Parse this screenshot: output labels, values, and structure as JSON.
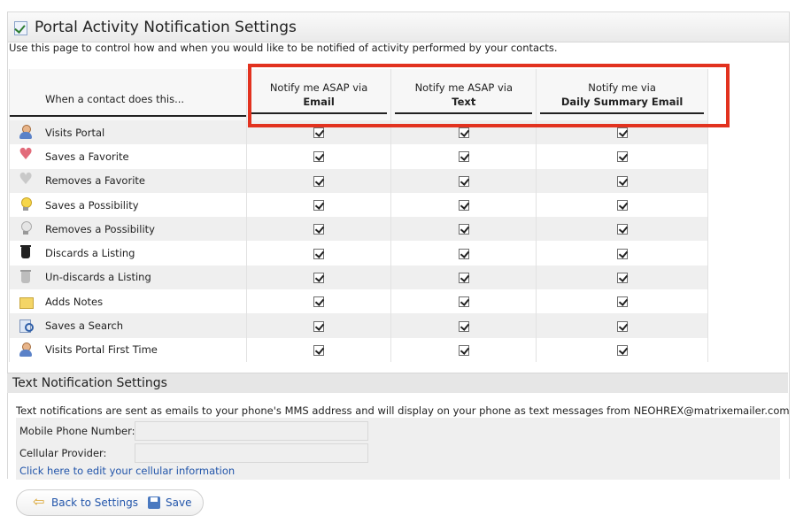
{
  "panel": {
    "title": "Portal Activity Notification Settings"
  },
  "intro": "Use this page to control how and when you would like to be notified of activity performed by your contacts.",
  "table": {
    "action_header": "When a contact does this...",
    "columns": [
      {
        "line1": "Notify me ASAP via",
        "line2": "Email"
      },
      {
        "line1": "Notify me ASAP via",
        "line2": "Text"
      },
      {
        "line1": "Notify me via",
        "line2": "Daily Summary Email"
      }
    ],
    "rows": [
      {
        "label": "Visits Portal",
        "icon": "person-icon",
        "email": true,
        "text": true,
        "daily": true
      },
      {
        "label": "Saves a Favorite",
        "icon": "heart-red-icon",
        "email": true,
        "text": true,
        "daily": true
      },
      {
        "label": "Removes a Favorite",
        "icon": "heart-grey-icon",
        "email": true,
        "text": true,
        "daily": true
      },
      {
        "label": "Saves a Possibility",
        "icon": "bulb-on-icon",
        "email": true,
        "text": true,
        "daily": true
      },
      {
        "label": "Removes a Possibility",
        "icon": "bulb-off-icon",
        "email": true,
        "text": true,
        "daily": true
      },
      {
        "label": "Discards a Listing",
        "icon": "trash-black-icon",
        "email": true,
        "text": true,
        "daily": true
      },
      {
        "label": "Un-discards a Listing",
        "icon": "trash-grey-icon",
        "email": true,
        "text": true,
        "daily": true
      },
      {
        "label": "Adds Notes",
        "icon": "note-icon",
        "email": true,
        "text": true,
        "daily": true
      },
      {
        "label": "Saves a Search",
        "icon": "search-icon",
        "email": true,
        "text": true,
        "daily": true
      },
      {
        "label": "Visits Portal First Time",
        "icon": "person-icon",
        "email": true,
        "text": true,
        "daily": true
      }
    ]
  },
  "text_settings": {
    "title": "Text Notification Settings",
    "description": "Text notifications are sent as emails to your phone's MMS address and will display on your phone as text messages from NEOHREX@matrixemailer.com",
    "mobile_label": "Mobile Phone Number:",
    "mobile_value": "",
    "provider_label": "Cellular Provider:",
    "provider_value": "",
    "edit_link": "Click here to edit your cellular information"
  },
  "buttons": {
    "back": "Back to Settings",
    "save": "Save"
  },
  "colors": {
    "highlight": "#e2321f",
    "link": "#2255aa"
  }
}
